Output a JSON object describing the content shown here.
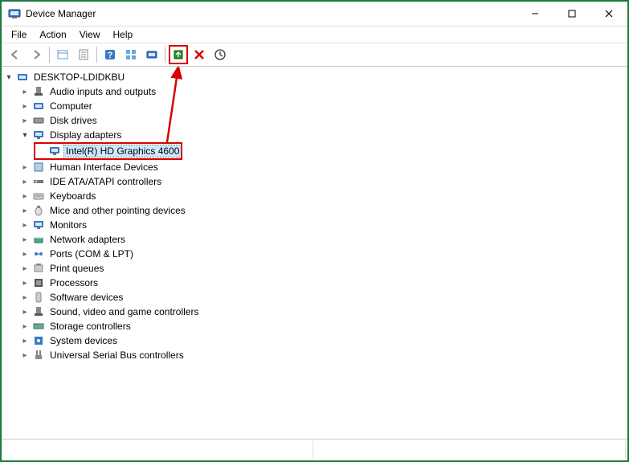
{
  "window": {
    "title": "Device Manager"
  },
  "menu": {
    "file": "File",
    "action": "Action",
    "view": "View",
    "help": "Help"
  },
  "toolbar_icons": {
    "back": "back-icon",
    "forward": "forward-icon",
    "show": "show-hidden-icon",
    "props": "properties-icon",
    "help": "help-icon",
    "grid": "grid-icon",
    "scan": "scan-hardware-icon",
    "update": "update-driver-icon",
    "uninstall": "uninstall-device-icon",
    "disable": "disable-device-icon"
  },
  "root": "DESKTOP-LDIDKBU",
  "categories": [
    {
      "label": "Audio inputs and outputs",
      "expanded": false
    },
    {
      "label": "Computer",
      "expanded": false
    },
    {
      "label": "Disk drives",
      "expanded": false
    },
    {
      "label": "Display adapters",
      "expanded": true,
      "children": [
        {
          "label": "Intel(R) HD Graphics 4600",
          "selected": true
        }
      ]
    },
    {
      "label": "Human Interface Devices",
      "expanded": false
    },
    {
      "label": "IDE ATA/ATAPI controllers",
      "expanded": false
    },
    {
      "label": "Keyboards",
      "expanded": false
    },
    {
      "label": "Mice and other pointing devices",
      "expanded": false
    },
    {
      "label": "Monitors",
      "expanded": false
    },
    {
      "label": "Network adapters",
      "expanded": false
    },
    {
      "label": "Ports (COM & LPT)",
      "expanded": false
    },
    {
      "label": "Print queues",
      "expanded": false
    },
    {
      "label": "Processors",
      "expanded": false
    },
    {
      "label": "Software devices",
      "expanded": false
    },
    {
      "label": "Sound, video and game controllers",
      "expanded": false
    },
    {
      "label": "Storage controllers",
      "expanded": false
    },
    {
      "label": "System devices",
      "expanded": false
    },
    {
      "label": "Universal Serial Bus controllers",
      "expanded": false
    }
  ],
  "annotation": {
    "highlighted_toolbar_button": "update-driver-icon",
    "highlighted_tree_item": "Intel(R) HD Graphics 4600"
  }
}
